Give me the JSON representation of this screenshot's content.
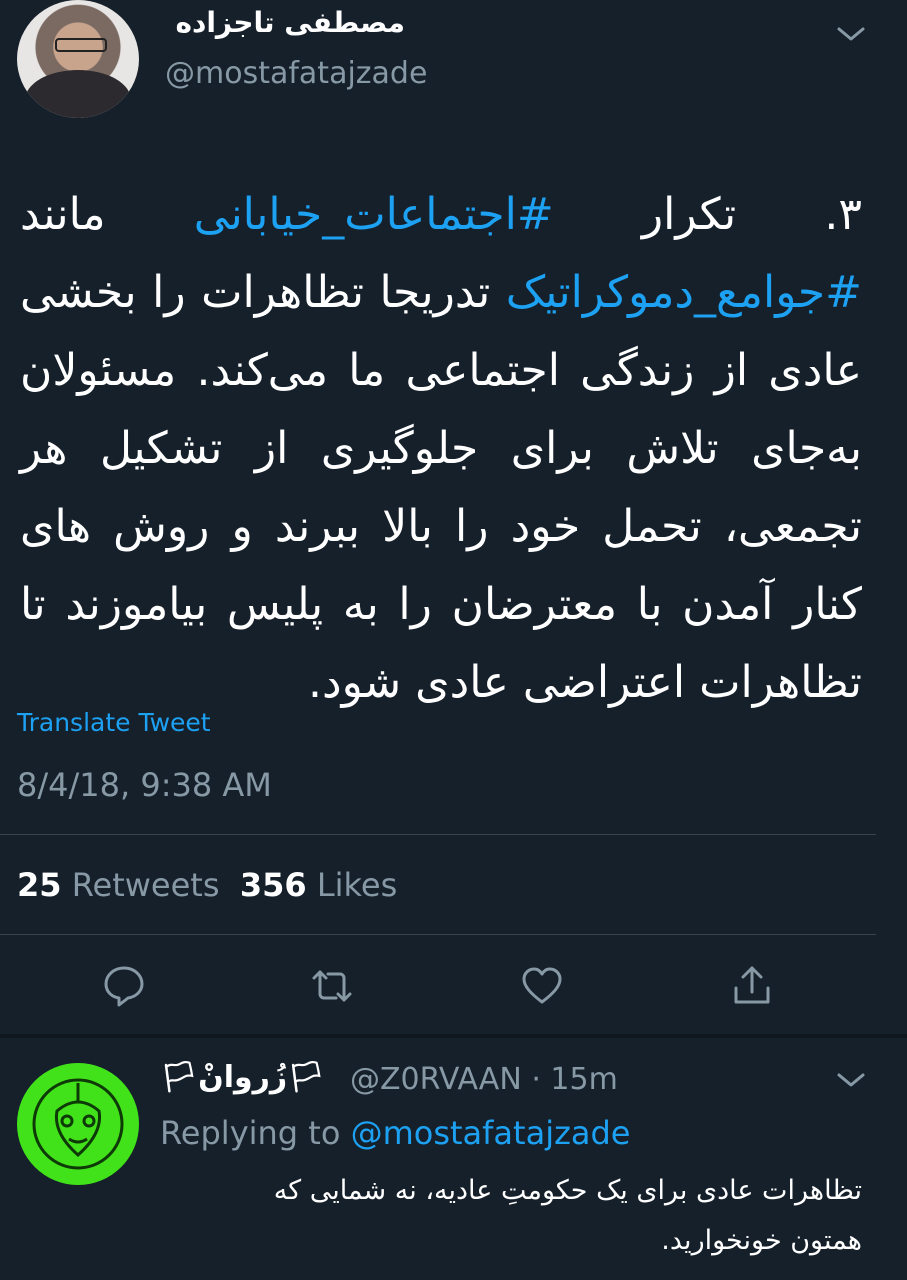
{
  "tweet": {
    "display_name": "مصطفی تاجزاده",
    "handle": "@mostafatajzade",
    "text_parts": [
      {
        "text": "۳. تکرار ",
        "type": "text"
      },
      {
        "text": "#اجتماعات_خیابانی",
        "type": "hashtag"
      },
      {
        "text": " مانند ",
        "type": "text"
      },
      {
        "text": "#جوامع_دموکراتیک",
        "type": "hashtag"
      },
      {
        "text": " تدریجا تظاهرات را بخشی عادی از زندگی اجتماعی ما می‌کند. مسئولان به‌جای تلاش برای جلوگیری از تشکیل هر تجمعی، تحمل خود را بالا ببرند و روش های کنار آمدن با معترضان را به پلیس بیاموزند تا تظاهرات اعتراضی عادی شود.",
        "type": "text"
      }
    ],
    "translate_label": "Translate Tweet",
    "timestamp": "8/4/18, 9:38 AM",
    "retweets_count": "25",
    "retweets_label": "Retweets",
    "likes_count": "356",
    "likes_label": "Likes"
  },
  "actions": [
    {
      "name": "reply-icon"
    },
    {
      "name": "retweet-icon"
    },
    {
      "name": "like-icon"
    },
    {
      "name": "share-icon"
    }
  ],
  "reply": {
    "display_name": "🏳زُروانْ🏳",
    "handle": "@Z0RVAAN",
    "separator": "·",
    "time": "15m",
    "replying_label": "Replying to",
    "replying_to": "@mostafatajzade",
    "text_line1": "تظاهرات عادی برای یک حکومتِ عادیه، نه شمایی که",
    "text_line2": "همتون خونخوارید."
  },
  "colors": {
    "background": "#15202b",
    "accent": "#1da1f2",
    "secondary_text": "#8899a6",
    "divider": "#38444d"
  }
}
